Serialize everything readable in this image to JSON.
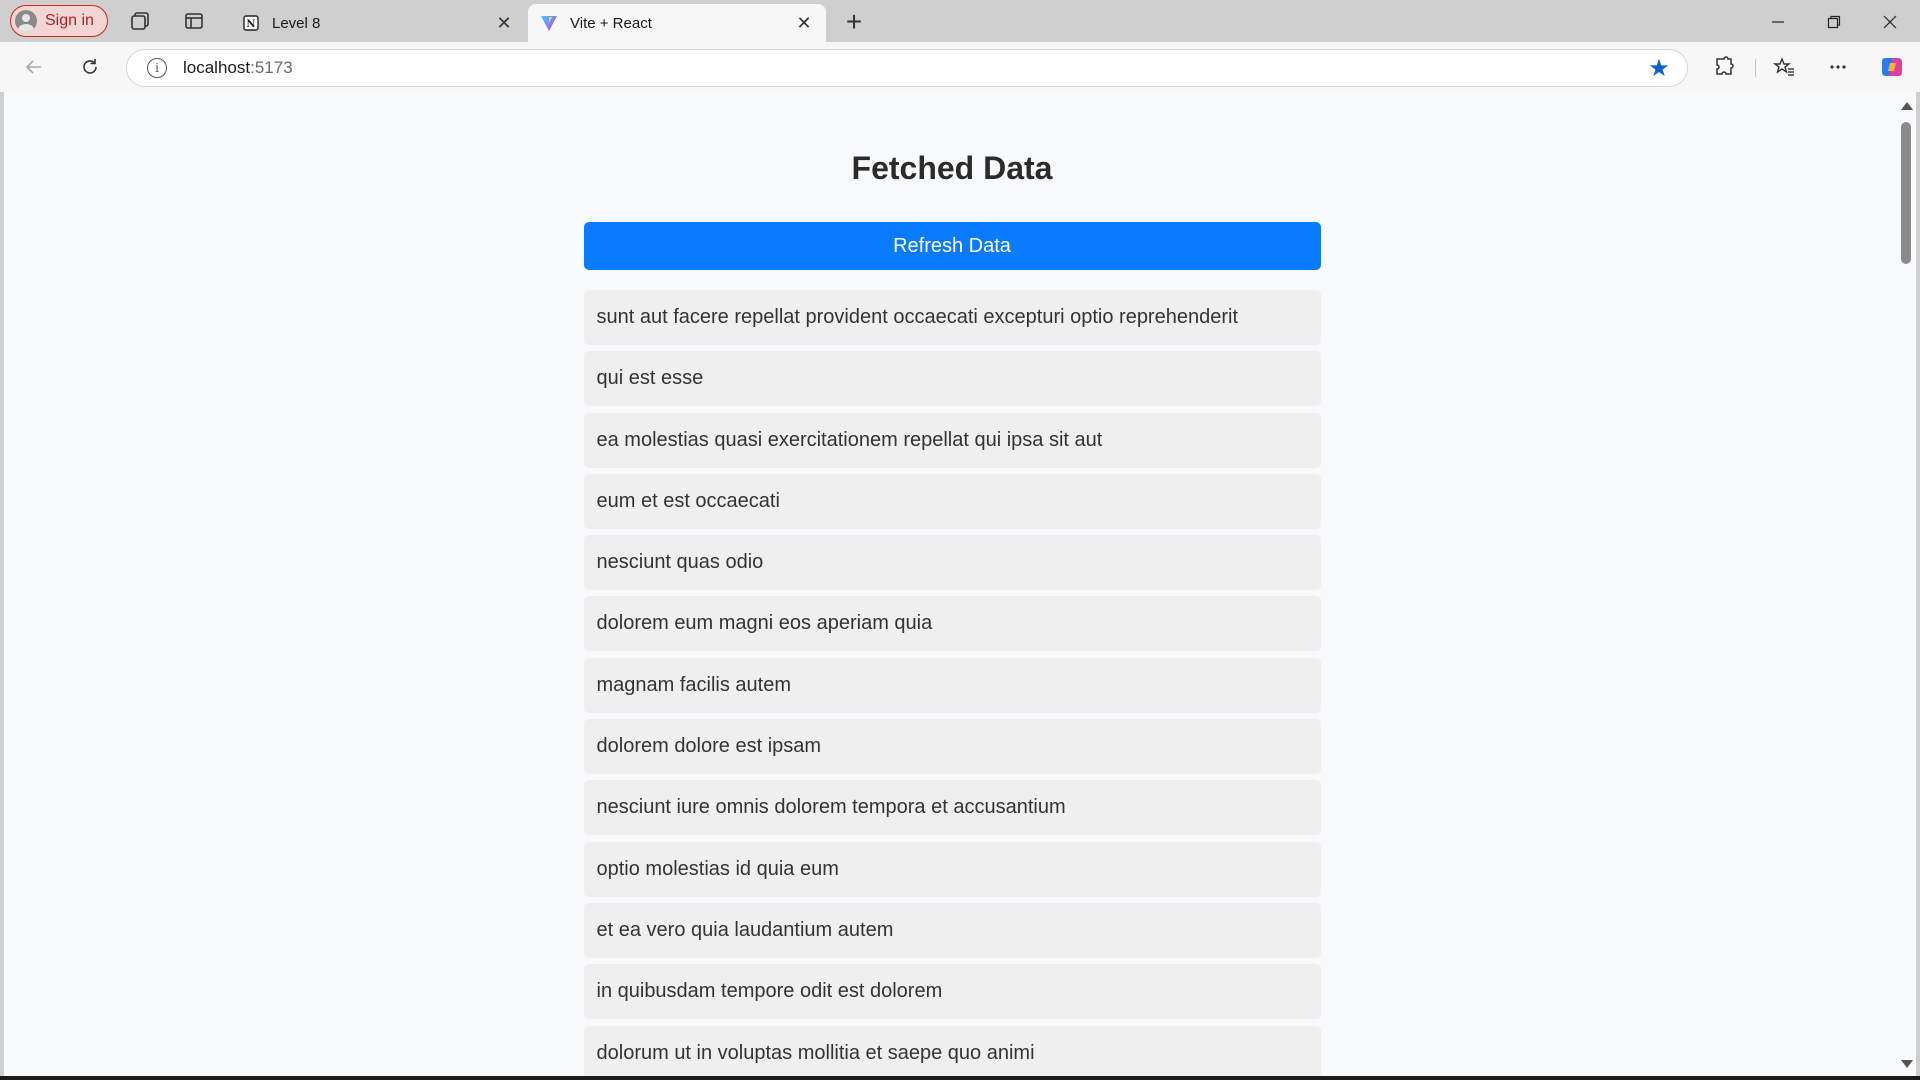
{
  "browser": {
    "signin_label": "Sign in",
    "tabs": [
      {
        "title": "Level 8",
        "favicon": "notion-icon",
        "active": false
      },
      {
        "title": "Vite + React",
        "favicon": "vite-icon",
        "active": true
      }
    ],
    "address": {
      "host": "localhost",
      "port": ":5173"
    },
    "accent_color": "#0b63d0"
  },
  "page": {
    "heading": "Fetched Data",
    "refresh_label": "Refresh Data",
    "button_color": "#0a7bff",
    "items": [
      "sunt aut facere repellat provident occaecati excepturi optio reprehenderit",
      "qui est esse",
      "ea molestias quasi exercitationem repellat qui ipsa sit aut",
      "eum et est occaecati",
      "nesciunt quas odio",
      "dolorem eum magni eos aperiam quia",
      "magnam facilis autem",
      "dolorem dolore est ipsam",
      "nesciunt iure omnis dolorem tempora et accusantium",
      "optio molestias id quia eum",
      "et ea vero quia laudantium autem",
      "in quibusdam tempore odit est dolorem",
      "dolorum ut in voluptas mollitia et saepe quo animi"
    ]
  }
}
